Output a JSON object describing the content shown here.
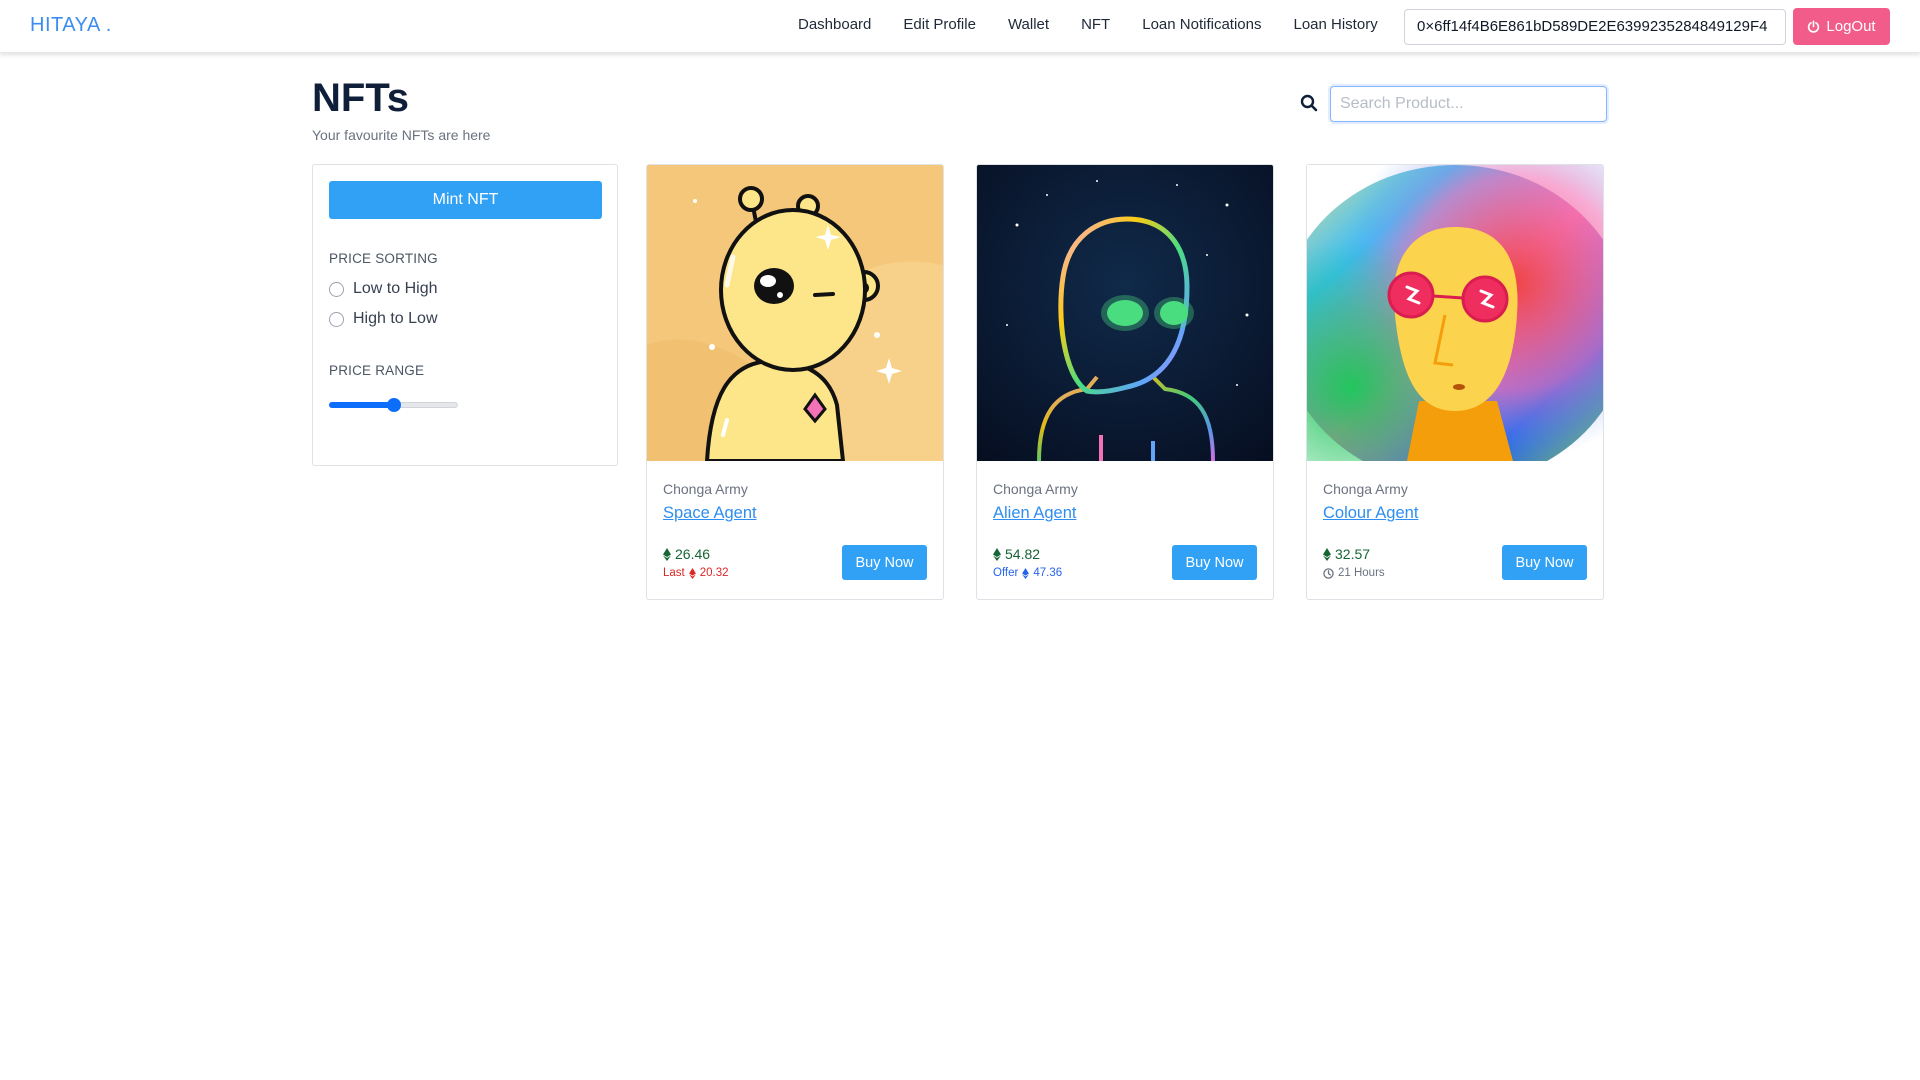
{
  "brand": "HITAYA .",
  "nav": {
    "links": [
      "Dashboard",
      "Edit Profile",
      "Wallet",
      "NFT",
      "Loan Notifications",
      "Loan History"
    ],
    "wallet_address": "0×6ff14f4B6E861bD589DE2E6399235284849129F4",
    "logout_label": "LogOut",
    "logout_color": "#f25c8b"
  },
  "header": {
    "title": "NFTs",
    "subtitle": "Your favourite NFTs are here",
    "search_placeholder": "Search Product..."
  },
  "sidebar": {
    "mint_label": "Mint NFT",
    "sorting_label": "PRICE SORTING",
    "sort_options": [
      "Low to High",
      "High to Low"
    ],
    "range_label": "PRICE RANGE",
    "range_value_fraction": 0.5
  },
  "cards": [
    {
      "collection": "Chonga Army",
      "name": "Space Agent",
      "price": "26.46",
      "sub_prefix": "Last",
      "sub_value": "20.32",
      "sub_color": "#dc2626",
      "sub_icon": "ethereum-icon",
      "buy_label": "Buy Now",
      "image_theme": "yellow-alien"
    },
    {
      "collection": "Chonga Army",
      "name": "Alien Agent",
      "price": "54.82",
      "sub_prefix": "Offer",
      "sub_value": "47.36",
      "sub_color": "#2563eb",
      "sub_icon": "ethereum-icon",
      "buy_label": "Buy Now",
      "image_theme": "neon-alien"
    },
    {
      "collection": "Chonga Army",
      "name": "Colour Agent",
      "price": "32.57",
      "sub_prefix": "",
      "sub_value": "21 Hours",
      "sub_color": "#6b7280",
      "sub_icon": "clock-icon",
      "buy_label": "Buy Now",
      "image_theme": "rainbow-face"
    }
  ],
  "colors": {
    "primary": "#30a1f5",
    "brand": "#3b8ef0",
    "price_green": "#166534"
  }
}
